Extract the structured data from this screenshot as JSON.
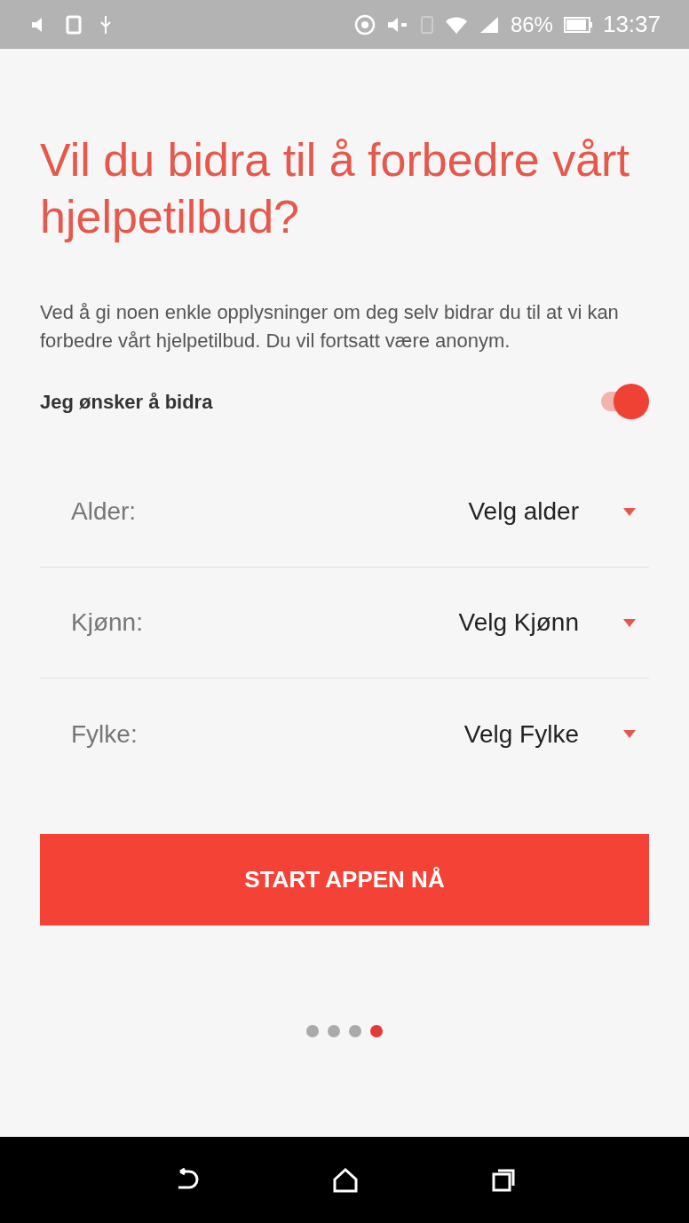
{
  "status_bar": {
    "battery": "86%",
    "time": "13:37"
  },
  "title": "Vil du bidra til å forbedre vårt hjelpetilbud?",
  "description": "Ved å gi noen enkle opplysninger om deg selv bidrar du til at vi kan forbedre vårt hjelpetilbud. Du vil fortsatt være anonym.",
  "consent": {
    "label": "Jeg ønsker å bidra",
    "on": true
  },
  "fields": [
    {
      "label": "Alder:",
      "value": "Velg alder"
    },
    {
      "label": "Kjønn:",
      "value": "Velg Kjønn"
    },
    {
      "label": "Fylke:",
      "value": "Velg Fylke"
    }
  ],
  "button": "START APPEN NÅ",
  "page_dots": [
    {
      "selected": false
    },
    {
      "selected": false
    },
    {
      "selected": false
    },
    {
      "selected": true
    }
  ]
}
